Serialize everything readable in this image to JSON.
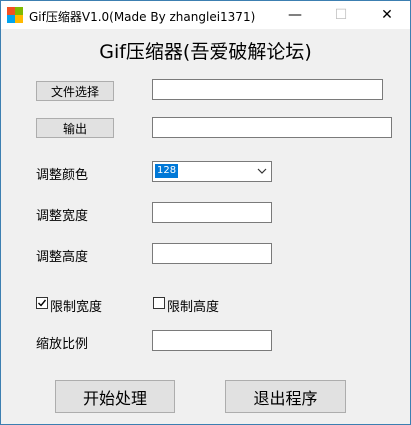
{
  "window": {
    "title": "Gif压缩器V1.0(Made By zhanglei1371)",
    "minimize_glyph": "—",
    "maximize_glyph": "☐",
    "close_glyph": "✕",
    "icon": "app-grid-icon"
  },
  "heading": "Gif压缩器(吾爱破解论坛)",
  "file_select": {
    "button_label": "文件选择",
    "value": ""
  },
  "output": {
    "button_label": "输出",
    "value": ""
  },
  "color": {
    "label": "调整颜色",
    "selected": "128"
  },
  "width": {
    "label": "调整宽度",
    "value": ""
  },
  "height": {
    "label": "调整高度",
    "value": ""
  },
  "limit_width": {
    "label": "限制宽度",
    "checked": true
  },
  "limit_height": {
    "label": "限制高度",
    "checked": false
  },
  "scale": {
    "label": "缩放比例",
    "value": ""
  },
  "actions": {
    "start_label": "开始处理",
    "exit_label": "退出程序"
  }
}
